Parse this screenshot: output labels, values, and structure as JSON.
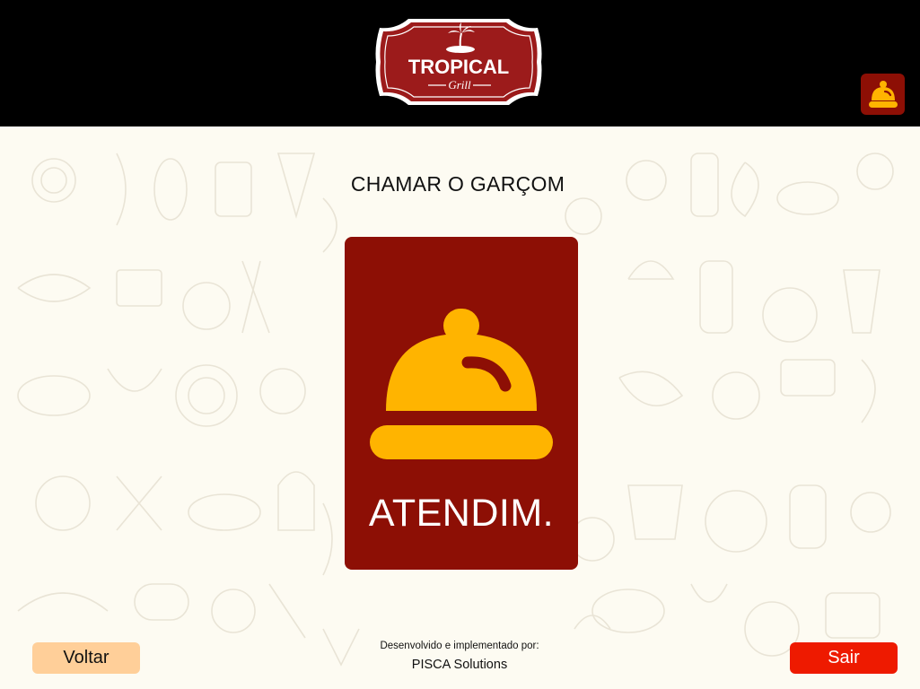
{
  "header": {
    "logo": {
      "brand": "TROPICAL",
      "sub": "Grill"
    }
  },
  "main": {
    "title": "CHAMAR O GARÇOM",
    "card": {
      "label": "ATENDIM.",
      "icon": "service-bell-icon"
    }
  },
  "footer": {
    "back_label": "Voltar",
    "exit_label": "Sair",
    "credit_line1": "Desenvolvido e implementado por:",
    "credit_line2": "PISCA Solutions"
  },
  "colors": {
    "header_bg": "#000000",
    "accent_dark_red": "#8d0f05",
    "bell_yellow": "#ffb400",
    "back_button": "#ffcf99",
    "exit_button": "#ee1a00",
    "background": "#fdfbf2"
  }
}
